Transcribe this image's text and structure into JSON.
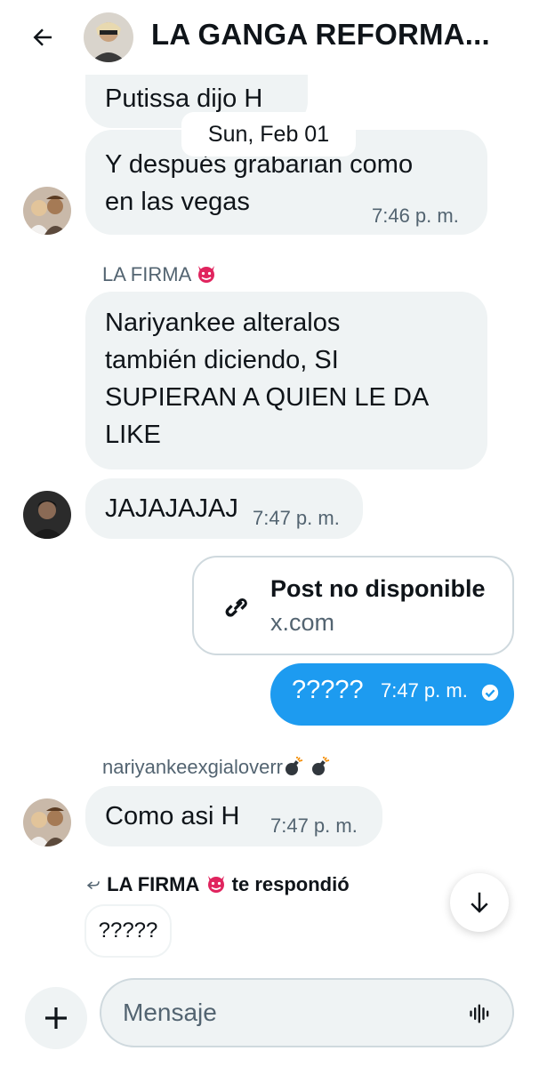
{
  "header": {
    "title": "LA GANGA REFORMA..."
  },
  "date_separator": "Sun, Feb 01",
  "messages": [
    {
      "text": "Putissa dijo H"
    },
    {
      "text": "Y después grabarian como\nen las vegas",
      "time": "7:46 p. m."
    },
    {
      "sender": "LA FIRMA",
      "text": "Nariyankee alteralos\ntambién diciendo, SI\nSUPIERAN A QUIEN LE DA\nLIKE"
    },
    {
      "text": "JAJAJAJAJ",
      "time": "7:47 p. m."
    },
    {
      "card_title": "Post no disponible",
      "card_domain": "x.com"
    },
    {
      "text": "?????",
      "time": "7:47 p. m.",
      "own": true
    },
    {
      "sender": "nariyankeexgialoverr",
      "text": "Como asi H",
      "time": "7:47 p. m."
    }
  ],
  "reply_note": {
    "name": "LA FIRMA",
    "suffix": "te respondió",
    "quoted": "?????"
  },
  "composer": {
    "placeholder": "Mensaje"
  },
  "colors": {
    "accent": "#1d9bf0",
    "bubble": "#eff3f4",
    "muted": "#536471"
  },
  "icons": [
    "back-arrow-icon",
    "link-icon",
    "check-circle-icon",
    "arrow-down-icon",
    "plus-icon",
    "voice-wave-icon",
    "reply-arrow-icon",
    "devil-emoji-icon",
    "bomb-emoji-icon"
  ]
}
